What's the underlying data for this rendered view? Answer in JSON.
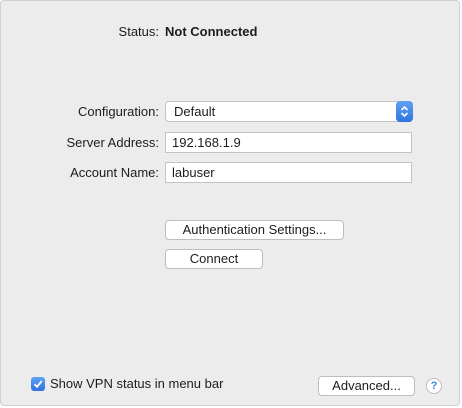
{
  "status": {
    "label": "Status:",
    "value": "Not Connected"
  },
  "configuration": {
    "label": "Configuration:",
    "value": "Default"
  },
  "server_address": {
    "label": "Server Address:",
    "value": "192.168.1.9"
  },
  "account_name": {
    "label": "Account Name:",
    "value": "labuser"
  },
  "buttons": {
    "auth_settings": "Authentication Settings...",
    "connect": "Connect",
    "advanced": "Advanced..."
  },
  "show_vpn_status": {
    "label": "Show VPN status in menu bar",
    "checked": true
  },
  "help": "?",
  "colors": {
    "accent": "#3b7ee8",
    "panel_bg": "#ececec"
  },
  "icons": [
    "updown-chevron-icon",
    "checkmark-icon",
    "help-icon"
  ]
}
